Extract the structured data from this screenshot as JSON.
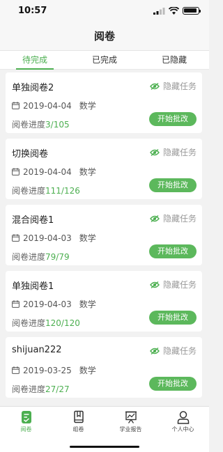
{
  "status_bar": {
    "time": "10:57"
  },
  "nav": {
    "title": "阅卷"
  },
  "tabs": [
    {
      "label": "待完成",
      "active": true
    },
    {
      "label": "已完成",
      "active": false
    },
    {
      "label": "已隐藏",
      "active": false
    }
  ],
  "cards": [
    {
      "title": "单独阅卷2",
      "hide_label": "隐藏任务",
      "date": "2019-04-04",
      "subject": "数学",
      "progress_label": "阅卷进度",
      "progress_value": "3/105",
      "button": "开始批改"
    },
    {
      "title": "切换阅卷",
      "hide_label": "隐藏任务",
      "date": "2019-04-04",
      "subject": "数学",
      "progress_label": "阅卷进度",
      "progress_value": "111/126",
      "button": "开始批改"
    },
    {
      "title": "混合阅卷1",
      "hide_label": "隐藏任务",
      "date": "2019-04-03",
      "subject": "数学",
      "progress_label": "阅卷进度",
      "progress_value": "79/79",
      "button": "开始批改"
    },
    {
      "title": "单独阅卷1",
      "hide_label": "隐藏任务",
      "date": "2019-04-03",
      "subject": "数学",
      "progress_label": "阅卷进度",
      "progress_value": "120/120",
      "button": "开始批改"
    },
    {
      "title": "shijuan222",
      "hide_label": "隐藏任务",
      "date": "2019-03-25",
      "subject": "数学",
      "progress_label": "阅卷进度",
      "progress_value": "27/27",
      "button": "开始批改"
    }
  ],
  "bottom_nav": [
    {
      "label": "阅卷",
      "icon": "exam-paper-icon",
      "active": true
    },
    {
      "label": "组卷",
      "icon": "book-icon",
      "active": false
    },
    {
      "label": "学业报告",
      "icon": "chart-board-icon",
      "active": false
    },
    {
      "label": "个人中心",
      "icon": "person-icon",
      "active": false
    }
  ],
  "colors": {
    "accent": "#4caf50",
    "button": "#5cb85c",
    "muted": "#999999"
  }
}
